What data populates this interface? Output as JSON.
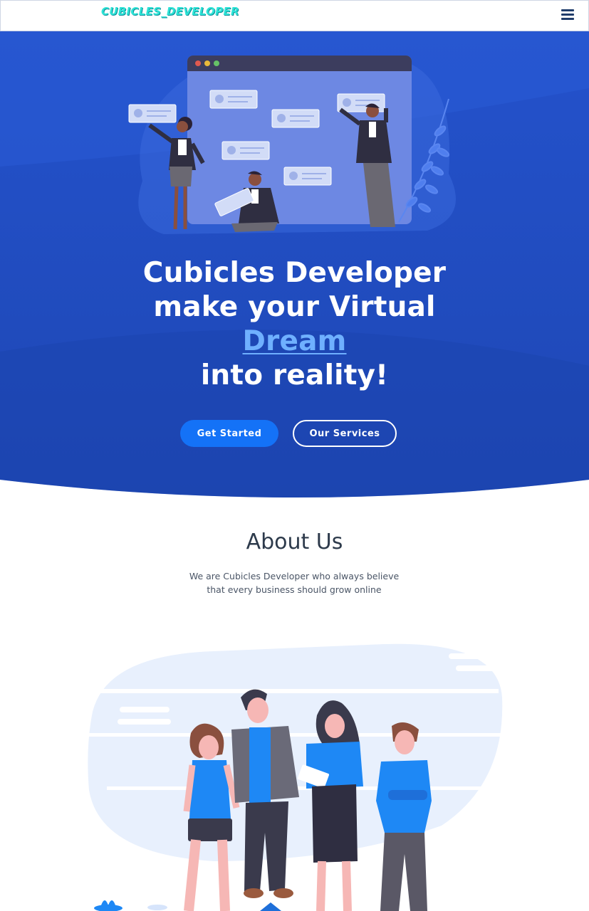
{
  "navbar": {
    "logo_text": "CUBICLES_DEVELOPER",
    "menu_icon": "hamburger-menu-icon"
  },
  "hero": {
    "title_line1": "Cubicles Developer",
    "title_line2": "make your Virtual",
    "title_accent": "Dream",
    "title_line4": "into reality!",
    "primary_button": "Get Started",
    "secondary_button": "Our Services",
    "illustration": "team-collaboration-illustration"
  },
  "about": {
    "title": "About Us",
    "text_line1": "We are Cubicles Developer who always believe",
    "text_line2": "that every business should grow online",
    "illustration": "team-people-illustration"
  },
  "colors": {
    "hero_background": "#1f4fc4",
    "accent": "#6fb0ff",
    "primary_button": "#1472f7",
    "logo": "#2de3d6",
    "heading": "#2d3a4b"
  }
}
